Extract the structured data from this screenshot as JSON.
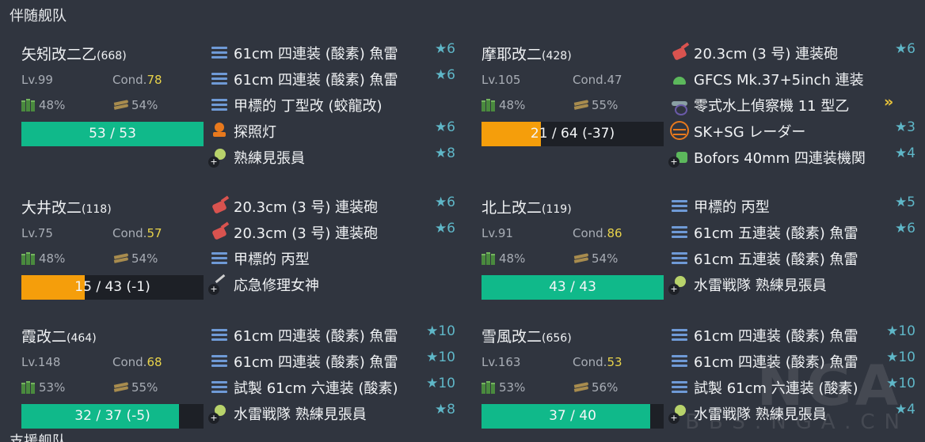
{
  "section_title": "伴随舰队",
  "section_title_next": "支援舰队",
  "watermark": {
    "main": "NGA",
    "sub": "BBS.NGA.CN"
  },
  "colors": {
    "background": "#30353f",
    "hp_green": "#10b98a",
    "hp_orange": "#f59e0b",
    "star": "#5fb7c8",
    "cond_sparkle": "#e8d34a"
  },
  "ships": [
    {
      "name": "矢矧改二乙",
      "id": "(668)",
      "lv": "Lv.99",
      "cond_label": "Cond.",
      "cond": "78",
      "cond_sparkle": true,
      "fuel": "48%",
      "ammo": "54%",
      "hp": "53 / 53",
      "hp_ratio": 1.0,
      "hp_color": "green",
      "equips": [
        {
          "icon": "torpedo-icon",
          "type": "bars",
          "name": "61cm 四連装 (酸素) 魚雷",
          "star": "★6"
        },
        {
          "icon": "torpedo-icon",
          "type": "bars",
          "name": "61cm 四連装 (酸素) 魚雷",
          "star": "★6"
        },
        {
          "icon": "midget-sub-icon",
          "type": "bars",
          "name": "甲標的 丁型改 (蛟龍改)",
          "star": ""
        },
        {
          "icon": "searchlight-icon",
          "type": "light",
          "name": "探照灯",
          "star": "★6"
        },
        {
          "icon": "lookout-icon",
          "type": "lookout",
          "name": "熟練見張員",
          "star": "★8"
        }
      ]
    },
    {
      "name": "摩耶改二",
      "id": "(428)",
      "lv": "Lv.105",
      "cond_label": "Cond.",
      "cond": "47",
      "cond_sparkle": false,
      "fuel": "48%",
      "ammo": "55%",
      "hp": "21 / 64 (-37)",
      "hp_ratio": 0.328,
      "hp_color": "orange",
      "equips": [
        {
          "icon": "gun-icon",
          "type": "gun",
          "name": "20.3cm (3 号) 連装砲",
          "star": "★6"
        },
        {
          "icon": "fire-control-icon",
          "type": "fcs",
          "name": "GFCS Mk.37+5inch 連装",
          "star": ""
        },
        {
          "icon": "seaplane-icon",
          "type": "plane",
          "name": "零式水上偵察機 11 型乙",
          "star": "",
          "proficiency": "»"
        },
        {
          "icon": "radar-icon",
          "type": "radar",
          "name": "SK+SG レーダー",
          "star": "★3"
        },
        {
          "icon": "aa-gun-icon",
          "type": "aa",
          "name": "Bofors 40mm 四連装機関",
          "star": "★4"
        }
      ]
    },
    {
      "name": "大井改二",
      "id": "(118)",
      "lv": "Lv.75",
      "cond_label": "Cond.",
      "cond": "57",
      "cond_sparkle": true,
      "fuel": "48%",
      "ammo": "54%",
      "hp": "15 / 43 (-1)",
      "hp_ratio": 0.349,
      "hp_color": "orange",
      "equips": [
        {
          "icon": "gun-icon",
          "type": "gun",
          "name": "20.3cm (3 号) 連装砲",
          "star": "★6"
        },
        {
          "icon": "gun-icon",
          "type": "gun",
          "name": "20.3cm (3 号) 連装砲",
          "star": "★6"
        },
        {
          "icon": "midget-sub-icon",
          "type": "bars",
          "name": "甲標的 丙型",
          "star": ""
        },
        {
          "icon": "repair-goddess-icon",
          "type": "repair",
          "name": "応急修理女神",
          "star": ""
        }
      ]
    },
    {
      "name": "北上改二",
      "id": "(119)",
      "lv": "Lv.91",
      "cond_label": "Cond.",
      "cond": "86",
      "cond_sparkle": true,
      "fuel": "48%",
      "ammo": "54%",
      "hp": "43 / 43",
      "hp_ratio": 1.0,
      "hp_color": "green",
      "equips": [
        {
          "icon": "midget-sub-icon",
          "type": "bars",
          "name": "甲標的 丙型",
          "star": "★5"
        },
        {
          "icon": "torpedo-icon",
          "type": "bars",
          "name": "61cm 五連装 (酸素) 魚雷",
          "star": "★6"
        },
        {
          "icon": "torpedo-icon",
          "type": "bars",
          "name": "61cm 五連装 (酸素) 魚雷",
          "star": ""
        },
        {
          "icon": "lookout-icon",
          "type": "lookout",
          "name": "水雷戦隊 熟練見張員",
          "star": ""
        }
      ]
    },
    {
      "name": "霞改二",
      "id": "(464)",
      "lv": "Lv.148",
      "cond_label": "Cond.",
      "cond": "68",
      "cond_sparkle": true,
      "fuel": "53%",
      "ammo": "55%",
      "hp": "32 / 37 (-5)",
      "hp_ratio": 0.865,
      "hp_color": "green",
      "equips": [
        {
          "icon": "torpedo-icon",
          "type": "bars",
          "name": "61cm 四連装 (酸素) 魚雷",
          "star": "★10"
        },
        {
          "icon": "torpedo-icon",
          "type": "bars",
          "name": "61cm 四連装 (酸素) 魚雷",
          "star": "★10"
        },
        {
          "icon": "torpedo-icon",
          "type": "bars",
          "name": "試製 61cm 六連装 (酸素)",
          "star": "★10"
        },
        {
          "icon": "lookout-icon",
          "type": "lookout",
          "name": "水雷戦隊 熟練見張員",
          "star": "★8"
        }
      ]
    },
    {
      "name": "雪風改二",
      "id": "(656)",
      "lv": "Lv.163",
      "cond_label": "Cond.",
      "cond": "53",
      "cond_sparkle": true,
      "fuel": "53%",
      "ammo": "56%",
      "hp": "37 / 40",
      "hp_ratio": 0.925,
      "hp_color": "green",
      "equips": [
        {
          "icon": "torpedo-icon",
          "type": "bars",
          "name": "61cm 四連装 (酸素) 魚雷",
          "star": "★10"
        },
        {
          "icon": "torpedo-icon",
          "type": "bars",
          "name": "61cm 四連装 (酸素) 魚雷",
          "star": "★10"
        },
        {
          "icon": "torpedo-icon",
          "type": "bars",
          "name": "試製 61cm 六連装 (酸素)",
          "star": "★10"
        },
        {
          "icon": "lookout-icon",
          "type": "lookout",
          "name": "水雷戦隊 熟練見張員",
          "star": "★4"
        }
      ]
    }
  ]
}
